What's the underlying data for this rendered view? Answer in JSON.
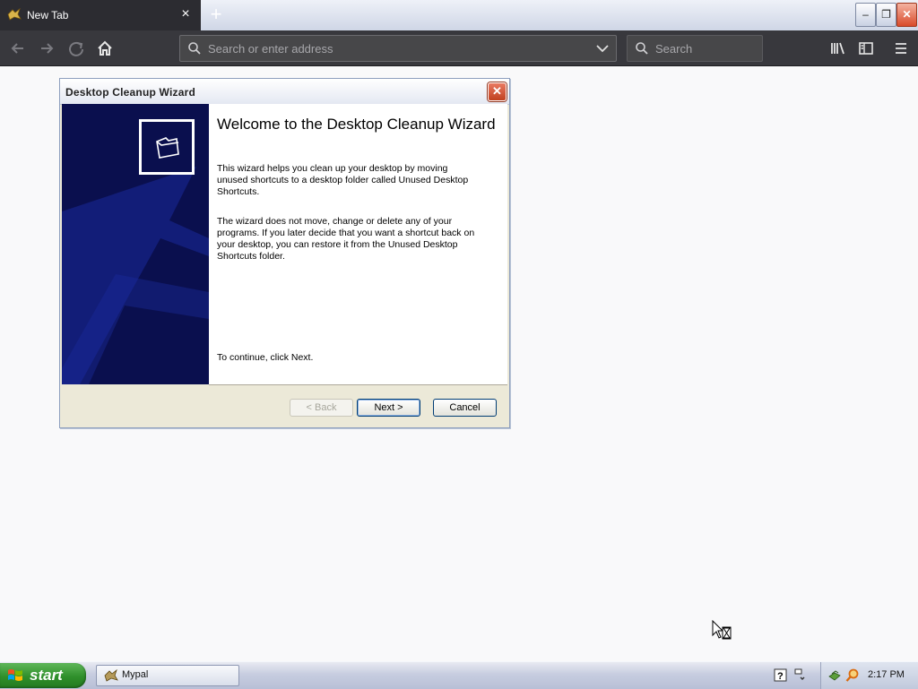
{
  "browser": {
    "tab_title": "New Tab",
    "new_tab_symbol": "+",
    "tab_close_symbol": "×",
    "address_placeholder": "Search or enter address",
    "search_placeholder": "Search",
    "window_controls": {
      "minimize": "–",
      "restore": "❐",
      "close": "✕"
    }
  },
  "wizard": {
    "title": "Desktop Cleanup Wizard",
    "close_symbol": "✕",
    "heading": "Welcome to the Desktop Cleanup Wizard",
    "paragraph1": "This wizard helps you clean up your desktop by moving unused shortcuts to a desktop folder called Unused Desktop Shortcuts.",
    "paragraph2": "The wizard does not move, change or delete any of your programs. If you later decide that you want a shortcut back on your desktop, you can restore it from the Unused Desktop Shortcuts folder.",
    "continue_text": "To continue, click Next.",
    "buttons": {
      "back": "< Back",
      "next": "Next >",
      "cancel": "Cancel"
    },
    "colors": {
      "side_panel": "#0a0f4e",
      "side_arrow": "#1a2a9a"
    }
  },
  "taskbar": {
    "start_label": "start",
    "task_item_label": "Mypal",
    "clock": "2:17 PM"
  },
  "icons": {
    "back": "arrow-left-icon",
    "forward": "arrow-right-icon",
    "reload": "reload-icon",
    "home": "home-icon",
    "library": "library-icon",
    "sidebar": "sidebar-icon",
    "menu": "hamburger-menu-icon",
    "folder": "folder-icon"
  }
}
